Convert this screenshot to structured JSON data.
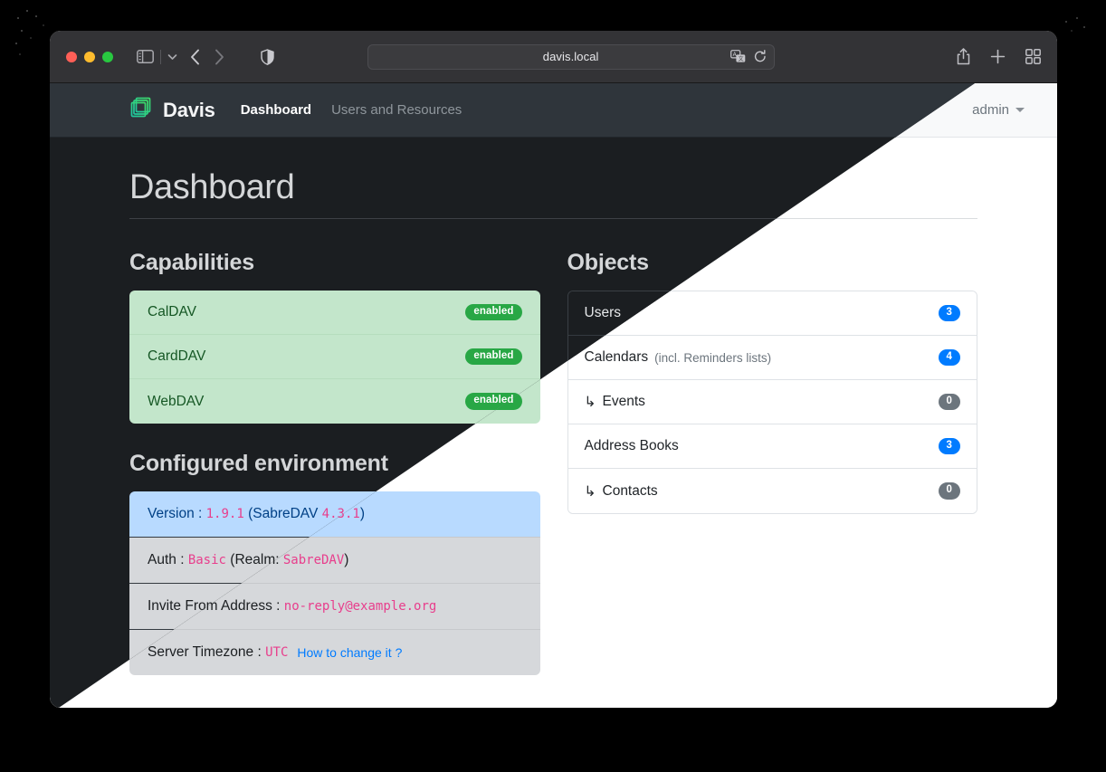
{
  "browser": {
    "url": "davis.local",
    "icons": {
      "sidebar": "sidebar-toggle-icon",
      "sidebar_dropdown": "chevron-down-icon",
      "back": "back-arrow-icon",
      "forward": "forward-arrow-icon",
      "shield": "privacy-shield-icon",
      "translate": "translate-icon",
      "reload": "reload-icon",
      "share": "share-icon",
      "new_tab": "plus-icon",
      "tab_overview": "tab-grid-icon"
    },
    "traffic_lights": [
      "close",
      "minimize",
      "maximize"
    ]
  },
  "navbar": {
    "brand": "Davis",
    "brand_icon": "stacked-squares-logo",
    "links": [
      {
        "label": "Dashboard",
        "active": true
      },
      {
        "label": "Users and Resources",
        "active": false
      }
    ],
    "user": "admin"
  },
  "page": {
    "title": "Dashboard"
  },
  "capabilities": {
    "heading": "Capabilities",
    "items": [
      {
        "label": "CalDAV",
        "status": "enabled"
      },
      {
        "label": "CardDAV",
        "status": "enabled"
      },
      {
        "label": "WebDAV",
        "status": "enabled"
      }
    ]
  },
  "environment": {
    "heading": "Configured environment",
    "items": [
      {
        "label": "Version :",
        "value": "1.9.1",
        "suffix_open": "(SabreDAV",
        "value2": "4.3.1",
        "suffix_close": ")",
        "active": true
      },
      {
        "label": "Auth :",
        "value": "Basic",
        "suffix_open": "(Realm:",
        "value2": "SabreDAV",
        "suffix_close": ")",
        "active": false
      },
      {
        "label": "Invite From Address :",
        "value": "no-reply@example.org",
        "active": false
      },
      {
        "label": "Server Timezone :",
        "value": "UTC",
        "link": "How to change it ?",
        "active": false
      }
    ]
  },
  "objects": {
    "heading": "Objects",
    "items": [
      {
        "label": "Users",
        "note": "",
        "sub": false,
        "count": "3",
        "zero": false
      },
      {
        "label": "Calendars",
        "note": "(incl. Reminders lists)",
        "sub": false,
        "count": "4",
        "zero": false
      },
      {
        "label": "Events",
        "note": "",
        "sub": true,
        "count": "0",
        "zero": true
      },
      {
        "label": "Address Books",
        "note": "",
        "sub": false,
        "count": "3",
        "zero": false
      },
      {
        "label": "Contacts",
        "note": "",
        "sub": true,
        "count": "0",
        "zero": true
      }
    ],
    "sub_arrow": "↳"
  },
  "colors": {
    "accent_green": "#28a745",
    "accent_blue": "#007bff",
    "muted_gray": "#6c757d",
    "code_pink": "#e83e8c",
    "dark_bg": "#1b1e21",
    "navbar_dark": "#2f353b"
  }
}
